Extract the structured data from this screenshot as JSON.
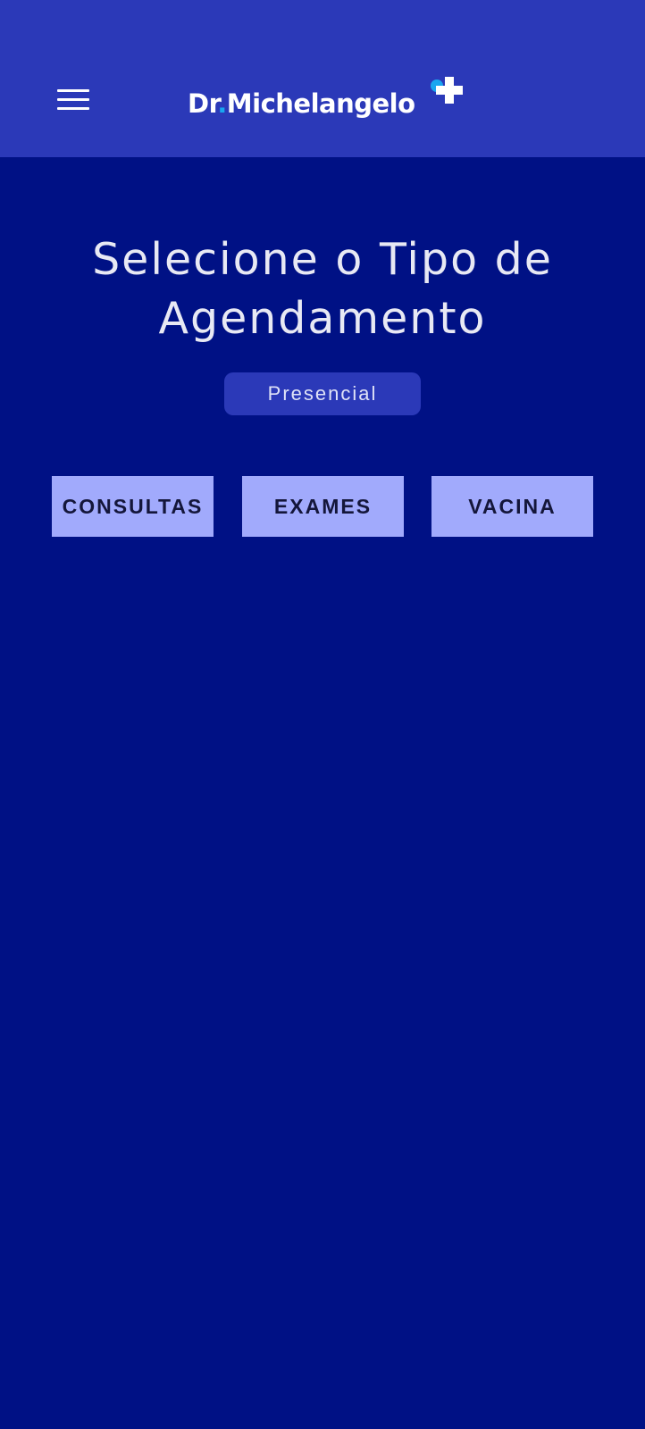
{
  "header": {
    "logo_prefix": "Dr",
    "logo_dot": ".",
    "logo_name": "Michelangelo",
    "menu_icon": "hamburger-menu-icon",
    "logo_icon": "medical-cross-icon",
    "logo_accent_color": "#19a6f0",
    "background_color": "#2b39b8"
  },
  "main": {
    "title_line1": "Selecione o Tipo de",
    "title_line2": "Agendamento",
    "mode_chip": "Presencial",
    "options": [
      {
        "label": "CONSULTAS"
      },
      {
        "label": "EXAMES"
      },
      {
        "label": "VACINA"
      }
    ],
    "background_color": "#001185",
    "button_color": "#a1aafc"
  }
}
